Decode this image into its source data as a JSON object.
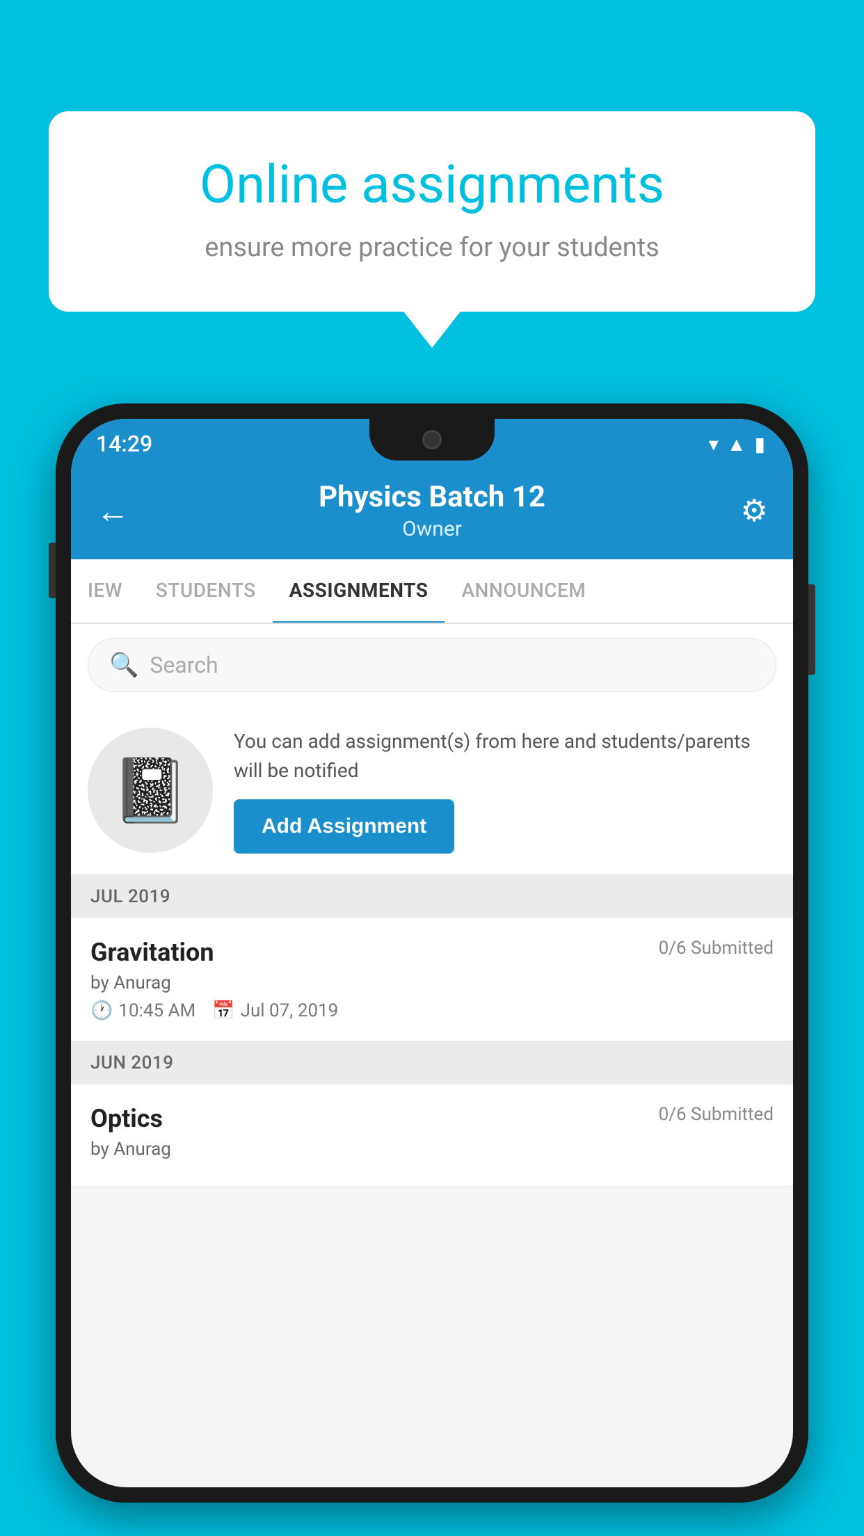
{
  "background_color": "#00BFDF",
  "speech_bubble": {
    "title": "Online assignments",
    "subtitle": "ensure more practice for your students"
  },
  "status_bar": {
    "time": "14:29",
    "icons": [
      "wifi",
      "signal",
      "battery"
    ]
  },
  "header": {
    "title": "Physics Batch 12",
    "subtitle": "Owner",
    "back_label": "←",
    "settings_label": "⚙"
  },
  "tabs": [
    {
      "label": "IEW",
      "active": false
    },
    {
      "label": "STUDENTS",
      "active": false
    },
    {
      "label": "ASSIGNMENTS",
      "active": true
    },
    {
      "label": "ANNOUNCEM",
      "active": false
    }
  ],
  "search": {
    "placeholder": "Search"
  },
  "promo": {
    "text": "You can add assignment(s) from here and students/parents will be notified",
    "button_label": "Add Assignment"
  },
  "months": [
    {
      "label": "JUL 2019",
      "assignments": [
        {
          "title": "Gravitation",
          "submitted": "0/6 Submitted",
          "author": "by Anurag",
          "time": "10:45 AM",
          "date": "Jul 07, 2019"
        }
      ]
    },
    {
      "label": "JUN 2019",
      "assignments": [
        {
          "title": "Optics",
          "submitted": "0/6 Submitted",
          "author": "by Anurag",
          "time": "",
          "date": ""
        }
      ]
    }
  ]
}
